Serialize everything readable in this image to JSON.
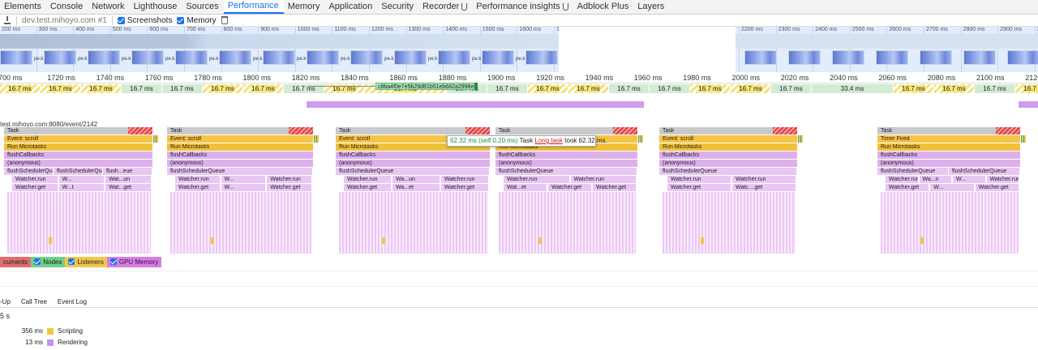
{
  "tabs": [
    {
      "label": "Elements"
    },
    {
      "label": "Console"
    },
    {
      "label": "Network"
    },
    {
      "label": "Lighthouse"
    },
    {
      "label": "Sources"
    },
    {
      "label": "Performance",
      "active": true
    },
    {
      "label": "Memory"
    },
    {
      "label": "Application"
    },
    {
      "label": "Security"
    },
    {
      "label": "Recorder",
      "flask": true
    },
    {
      "label": "Performance insights",
      "flask": true
    },
    {
      "label": "Adblock Plus"
    },
    {
      "label": "Layers"
    }
  ],
  "toolbar": {
    "recording": "dev.test.mihoyo.com #1",
    "screenshots_label": "Screenshots",
    "memory_label": "Memory"
  },
  "overview": {
    "ticks": [
      "200 ms",
      "300 ms",
      "400 ms",
      "500 ms",
      "600 ms",
      "700 ms",
      "800 ms",
      "900 ms",
      "1000 ms",
      "1100 ms",
      "1200 ms",
      "1300 ms",
      "1400 ms",
      "1500 ms",
      "1600 ms",
      "17",
      "1800 ms",
      "1900 ms",
      "2000 ms",
      "2100 ms",
      "2200 ms",
      "2300 ms",
      "2400 ms",
      "2500 ms",
      "2600 ms",
      "2700 ms",
      "2800 ms",
      "2900 ms",
      "300"
    ],
    "shot_label": "pe.k.kz"
  },
  "ruler": [
    "700 ms",
    "1720 ms",
    "1740 ms",
    "1760 ms",
    "1780 ms",
    "1800 ms",
    "1820 ms",
    "1840 ms",
    "1860 ms",
    "1880 ms",
    "1900 ms",
    "1920 ms",
    "1940 ms",
    "1960 ms",
    "1980 ms",
    "2000 ms",
    "2020 ms",
    "2040 ms",
    "2060 ms",
    "2080 ms",
    "2100 ms",
    "2120"
  ],
  "frames": [
    {
      "t": "16.7 ms",
      "k": "part"
    },
    {
      "t": "16.7 ms",
      "k": "part"
    },
    {
      "t": "16.7 ms",
      "k": "part"
    },
    {
      "t": "16.7 ms",
      "k": "ok"
    },
    {
      "t": "16.7 ms",
      "k": "ok"
    },
    {
      "t": "16.7 ms",
      "k": "part"
    },
    {
      "t": "16.7 ms",
      "k": "part"
    },
    {
      "t": "16.7 ms",
      "k": "ok"
    },
    {
      "t": "16.7 ms",
      "k": "part"
    },
    {
      "t": "33.4 ms",
      "k": "part"
    },
    {
      "t": "16.7 ms",
      "k": "ok"
    },
    {
      "t": "16.7 ms",
      "k": "ok"
    },
    {
      "t": "16.7 ms",
      "k": "part"
    },
    {
      "t": "16.7 ms",
      "k": "part"
    },
    {
      "t": "16.7 ms",
      "k": "ok"
    },
    {
      "t": "16.7 ms",
      "k": "ok"
    },
    {
      "t": "16.7 ms",
      "k": "part"
    },
    {
      "t": "16.7 ms",
      "k": "part"
    },
    {
      "t": "16.7 ms",
      "k": "ok"
    },
    {
      "t": "33.4 ms",
      "k": "ok"
    },
    {
      "t": "16.7 ms",
      "k": "part"
    },
    {
      "t": "16.7 ms",
      "k": "part"
    },
    {
      "t": "16.7 ms",
      "k": "ok"
    },
    {
      "t": "16.7 ms",
      "k": "part"
    }
  ],
  "network": {
    "hash": "c8ba4f0e7e5b29d81b51eb682a2998e8..."
  },
  "main": {
    "label": "test.mihoyo.com:8080/event/2142",
    "columns": [
      {
        "rows": [
          "Task",
          "Event: scroll",
          "Run Microtasks",
          "flushCallbacks",
          "(anonymous)"
        ],
        "sq": [
          "flushSchedulerQueue",
          "flushSchedulerQueue",
          "flush...eue"
        ],
        "wr": [
          "Watcher.run",
          "W...",
          "Wat...un"
        ],
        "wg": [
          "Watcher.get",
          "W...t",
          "Wat...get"
        ]
      },
      {
        "rows": [
          "Task",
          "Event: scroll",
          "Run Microtasks",
          "flushCallbacks",
          "(anonymous)"
        ],
        "sq": [
          "flushSchedulerQueue"
        ],
        "wr": [
          "Watcher.run",
          "W...",
          "Watcher.run"
        ],
        "wg": [
          "Watcher.get",
          "W...",
          "Watcher.get"
        ]
      },
      {
        "rows": [
          "Task",
          "Event: scroll",
          "Run Microtasks",
          "flushCallbacks",
          "(anonymous)"
        ],
        "sq": [
          "flushSchedulerQueue"
        ],
        "wr": [
          "Watcher.run",
          "Wa...un",
          "Watcher.run"
        ],
        "wg": [
          "Watcher.get",
          "Wa...et",
          "Watcher.get"
        ]
      },
      {
        "rows": [
          "Task",
          "Event: scroll",
          "Run Microtasks",
          "flushCallbacks",
          "(anonymous)"
        ],
        "sq": [
          "flushSchedulerQueue"
        ],
        "wr": [
          "Watcher.run",
          "Watcher.run"
        ],
        "wg": [
          "Wat...et",
          "Watcher.get",
          "Watcher.get"
        ]
      },
      {
        "rows": [
          "Task",
          "Event: scroll",
          "Run Microtasks",
          "flushCallbacks",
          "(anonymous)"
        ],
        "sq": [
          "flushSchedulerQueue"
        ],
        "wr": [
          "Watcher.run",
          "Watcher.run"
        ],
        "wg": [
          "Watcher.get",
          "Watc....get"
        ]
      },
      {
        "rows": [
          "Task",
          "Timer Fired",
          "Run Microtasks",
          "flushCallbacks",
          "(anonymous)"
        ],
        "sq": [
          "flushSchedulerQueue",
          "flushSchedulerQueue"
        ],
        "wr": [
          "Watcher.run",
          "Wa...n",
          "W...",
          "Watcher.run"
        ],
        "wg": [
          "Watcher.get",
          "W...",
          "Watcher.get"
        ]
      }
    ]
  },
  "tooltip": {
    "time": "62.32 ms (self 0.20 ms)",
    "name": "Task",
    "link": "Long task",
    "rest": "took 62.32 ms."
  },
  "counters": [
    {
      "label": "cuments",
      "color": "#e26d6d"
    },
    {
      "label": "Nodes",
      "color": "#6fd08a"
    },
    {
      "label": "Listeners",
      "color": "#f3c74a"
    },
    {
      "label": "GPU Memory",
      "color": "#da7be6"
    }
  ],
  "bottom": {
    "tabs": [
      "-Up",
      "Call Tree",
      "Event Log"
    ],
    "total": "5 s",
    "summary": [
      {
        "value": "356 ms",
        "label": "Scripting",
        "color": "#f3c343"
      },
      {
        "value": "13 ms",
        "label": "Rendering",
        "color": "#c890ec"
      }
    ]
  }
}
